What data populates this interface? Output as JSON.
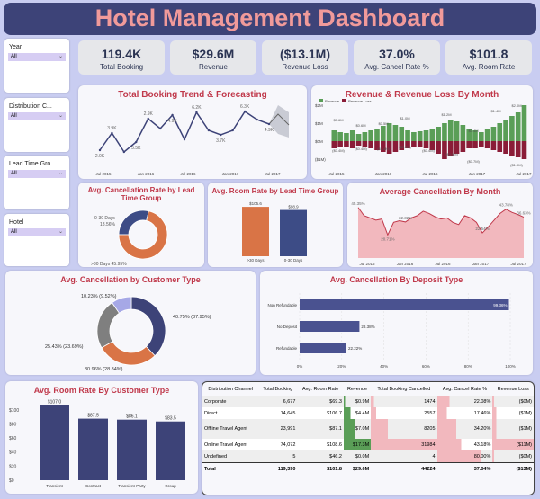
{
  "header": {
    "title": "Hotel Management Dashboard"
  },
  "slicers": [
    {
      "label": "Year",
      "value": "All"
    },
    {
      "label": "Distribution C...",
      "value": "All"
    },
    {
      "label": "Lead Time Gro...",
      "value": "All"
    },
    {
      "label": "Hotel",
      "value": "All"
    }
  ],
  "kpis": [
    {
      "value": "119.4K",
      "label": "Total Booking"
    },
    {
      "value": "$29.6M",
      "label": "Revenue"
    },
    {
      "value": "($13.1M)",
      "label": "Revenue Loss"
    },
    {
      "value": "37.0%",
      "label": "Avg. Cancel Rate %"
    },
    {
      "value": "$101.8",
      "label": "Avg. Room Rate"
    }
  ],
  "charts": {
    "trend": {
      "title": "Total Booking Trend & Forecasting"
    },
    "revenue": {
      "title": "Revenue & Revenue Loss By Month"
    },
    "leadcancel": {
      "title": "Avg. Cancellation Rate by Lead Time Group"
    },
    "leadrate": {
      "title": "Avg. Room Rate by Lead Time Group"
    },
    "cancelmonth": {
      "title": "Average Cancellation By Month"
    },
    "custtype": {
      "title": "Avg. Cancellation by Customer Type"
    },
    "deposit": {
      "title": "Avg. Cancellation By Deposit Type"
    },
    "roomrate": {
      "title": "Avg. Room Rate By Customer Type"
    }
  },
  "chart_data": [
    {
      "type": "line",
      "title": "Total Booking Trend & Forecasting",
      "x": [
        "Jul 2015",
        "Jan 2016",
        "Jul 2016",
        "Jan 2017",
        "Jul 2017"
      ],
      "point_labels": [
        "2.0K",
        "3.9K",
        "5.5K",
        "2.9K",
        "4.9K",
        "6.2K",
        "3.7K",
        "6.3K",
        "4.9K"
      ],
      "values": [
        2.0,
        3.9,
        1.8,
        2.9,
        5.5,
        4.4,
        5.9,
        3.2,
        6.2,
        4.2,
        3.7,
        4.2,
        6.3,
        5.4,
        4.9
      ],
      "forecast": [
        4.9,
        7.2,
        4.8
      ],
      "ylim": [
        0,
        7
      ]
    },
    {
      "type": "bar",
      "title": "Revenue & Revenue Loss By Month",
      "legend": [
        "Revenue",
        "Revenue Loss"
      ],
      "colors": [
        "#5a9e57",
        "#8a1c37"
      ],
      "x": [
        "Jul 2015",
        "Jan 2016",
        "Jul 2016",
        "Jan 2017",
        "Jul 2017"
      ],
      "yticks": [
        "$1M",
        "$0M",
        "($1M)",
        "$2M"
      ],
      "data_labels": [
        "$0.6M",
        "$0.6M",
        "$0.5M",
        "$1.0M",
        "$1.2M",
        "$2.0M",
        "$1.4M",
        "$0.4M",
        "($0.4M)",
        "($0.4M)",
        "($0.4M)",
        "($0.3M)",
        "($0.4M)",
        "($0.5M)",
        "($0.7M)",
        "($1.0M)"
      ],
      "revenue": [
        0.6,
        0.5,
        0.45,
        0.6,
        0.4,
        0.5,
        0.6,
        0.7,
        0.85,
        1.0,
        0.9,
        0.8,
        0.6,
        0.5,
        0.55,
        0.6,
        0.7,
        0.8,
        1.0,
        1.2,
        1.1,
        0.9,
        0.7,
        0.6,
        0.5,
        0.65,
        0.8,
        1.0,
        1.2,
        1.4,
        1.6,
        2.0
      ],
      "revenue_loss": [
        -0.4,
        -0.35,
        -0.3,
        -0.4,
        -0.25,
        -0.3,
        -0.4,
        -0.5,
        -0.6,
        -0.7,
        -0.6,
        -0.5,
        -0.4,
        -0.3,
        -0.35,
        -0.4,
        -0.5,
        -0.7,
        -1.0,
        -0.8,
        -0.7,
        -0.6,
        -0.4,
        -0.4,
        -0.3,
        -0.4,
        -0.5,
        -0.6,
        -0.7,
        -0.8,
        -0.9,
        -1.0
      ]
    },
    {
      "type": "pie",
      "title": "Avg. Cancellation Rate by Lead Time Group",
      "labels": [
        "0-30 Days",
        "> 30 Days"
      ],
      "values": [
        18.56,
        45.95
      ],
      "display": [
        "0-30 Days\n18.56%",
        ">30 Days 45.95%"
      ],
      "colors": [
        "#3d4c86",
        "#d97446"
      ]
    },
    {
      "type": "bar",
      "title": "Avg. Room Rate by Lead Time Group",
      "categories": [
        ">30 Days",
        "0-30 Days"
      ],
      "values": [
        105.6,
        98.9
      ],
      "display": [
        "$105.6",
        "$98.9"
      ],
      "colors": [
        "#d97446",
        "#3d4c86"
      ]
    },
    {
      "type": "area",
      "title": "Average Cancellation By Month",
      "x": [
        "Jul 2015",
        "Jan 2016",
        "Jul 2016",
        "Jan 2017",
        "Jul 2017"
      ],
      "data_labels": [
        "45.35%",
        "20.71%",
        "32.32%",
        "22.54%",
        "43.78%",
        "36.63%"
      ],
      "values": [
        45.35,
        38,
        36,
        34,
        35,
        20.71,
        32,
        33.5,
        32.32,
        36,
        38,
        42,
        40,
        37,
        35,
        36,
        32,
        30,
        38,
        36,
        32,
        22.54,
        28,
        34,
        40,
        43.78,
        41,
        39,
        36.63
      ],
      "ylim": [
        0,
        50
      ]
    },
    {
      "type": "pie",
      "title": "Avg. Cancellation by Customer Type",
      "labels": [
        "Transient",
        "Transient-Party",
        "Contract",
        "Group"
      ],
      "values": [
        40.75,
        30.96,
        25.43,
        10.23
      ],
      "display": [
        "40.75% (37.95%)",
        "30.96% (28.84%)",
        "25.43% (23.69%)",
        "10.23% (9.52%)"
      ],
      "colors": [
        "#3d4378",
        "#d97446",
        "#7f7f7f",
        "#a6a8e6"
      ]
    },
    {
      "type": "bar",
      "title": "Avg. Cancellation By Deposit Type",
      "categories": [
        "Non Refundable",
        "No Deposit",
        "Refundable"
      ],
      "values": [
        99.36,
        28.38,
        22.22
      ],
      "display": [
        "99.36%",
        "28.38%",
        "22.22%"
      ],
      "xticks": [
        "0%",
        "20%",
        "40%",
        "60%",
        "80%",
        "100%"
      ],
      "xlim": [
        0,
        100
      ]
    },
    {
      "type": "bar",
      "title": "Avg. Room Rate By Customer Type",
      "categories": [
        "Transient",
        "Contract",
        "Transient-Party",
        "Group"
      ],
      "values": [
        107.0,
        87.5,
        86.1,
        83.5
      ],
      "display": [
        "$107.0",
        "$87.5",
        "$86.1",
        "$83.5"
      ],
      "yticks": [
        "$0",
        "$20",
        "$40",
        "$60",
        "$80",
        "$100"
      ],
      "ylim": [
        0,
        110
      ]
    },
    {
      "type": "table",
      "title": "",
      "columns": [
        "Distribution Channel",
        "Total Booking",
        "Avg. Room Rate",
        "Revenue",
        "Total Booking Cancelled",
        "Avg. Cancel Rate %",
        "Revenue Loss"
      ],
      "rows": [
        [
          "Corporate",
          "6,677",
          "$69.3",
          "$0.9M",
          "1474",
          "22.08%",
          "($0M)"
        ],
        [
          "Direct",
          "14,645",
          "$106.7",
          "$4.4M",
          "2557",
          "17.46%",
          "($1M)"
        ],
        [
          "Offline Travel Agent",
          "23,991",
          "$87.1",
          "$7.0M",
          "8205",
          "34.20%",
          "($1M)"
        ],
        [
          "Online Travel Agent",
          "74,072",
          "$108.6",
          "$17.3M",
          "31984",
          "43.18%",
          "($11M)"
        ],
        [
          "Undefined",
          "5",
          "$46.2",
          "$0.0M",
          "4",
          "80.00%",
          "($0M)"
        ]
      ],
      "total": [
        "Total",
        "119,390",
        "$101.8",
        "$29.6M",
        "44224",
        "37.04%",
        "($13M)"
      ],
      "revenue_values": [
        0.9,
        4.4,
        7.0,
        17.3,
        0.0
      ],
      "cancelled_values": [
        1474,
        2557,
        8205,
        31984,
        4
      ],
      "cancel_rate_values": [
        22.08,
        17.46,
        34.2,
        43.18,
        80.0
      ]
    }
  ]
}
